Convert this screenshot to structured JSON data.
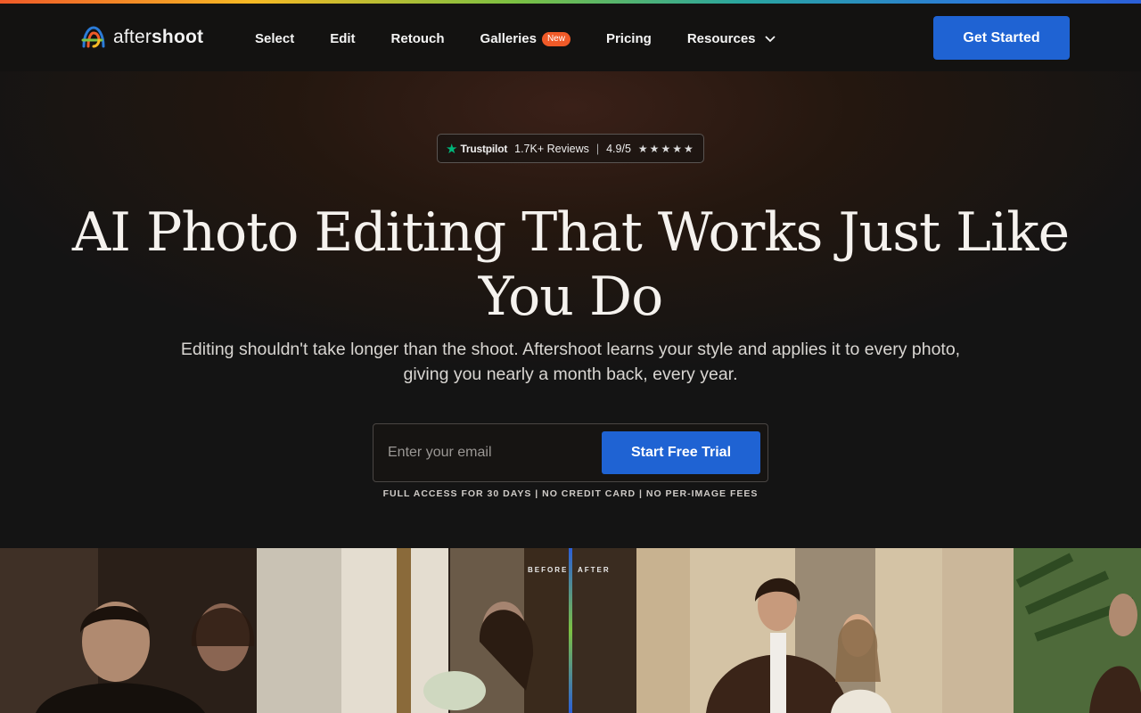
{
  "brand": {
    "name_light": "after",
    "name_bold": "shoot",
    "logo_icon": "aftershoot-logo-icon"
  },
  "nav": {
    "items": [
      {
        "label": "Select"
      },
      {
        "label": "Edit"
      },
      {
        "label": "Retouch"
      },
      {
        "label": "Galleries",
        "badge": "New"
      },
      {
        "label": "Pricing"
      },
      {
        "label": "Resources",
        "icon": "chevron-down-icon"
      }
    ],
    "cta": "Get Started"
  },
  "trustpilot": {
    "brand": "Trustpilot",
    "reviews": "1.7K+ Reviews",
    "rating": "4.9/5",
    "stars": "★★★★★",
    "separator": "|"
  },
  "hero": {
    "headline": "AI Photo Editing That Works Just Like You Do",
    "subhead": "Editing shouldn't take longer than the shoot. Aftershoot learns your style and applies it to every photo, giving you nearly a month back, every year.",
    "email_placeholder": "Enter your email",
    "trial_button": "Start Free Trial",
    "fine_print": "FULL ACCESS FOR 30 DAYS | NO CREDIT CARD | NO PER-IMAGE FEES"
  },
  "comparison": {
    "before_label": "BEFORE",
    "after_label": "AFTER"
  },
  "colors": {
    "accent": "#1f63d3",
    "badge": "#f05a28",
    "trustpilot_green": "#00b67a",
    "background": "#141414"
  }
}
